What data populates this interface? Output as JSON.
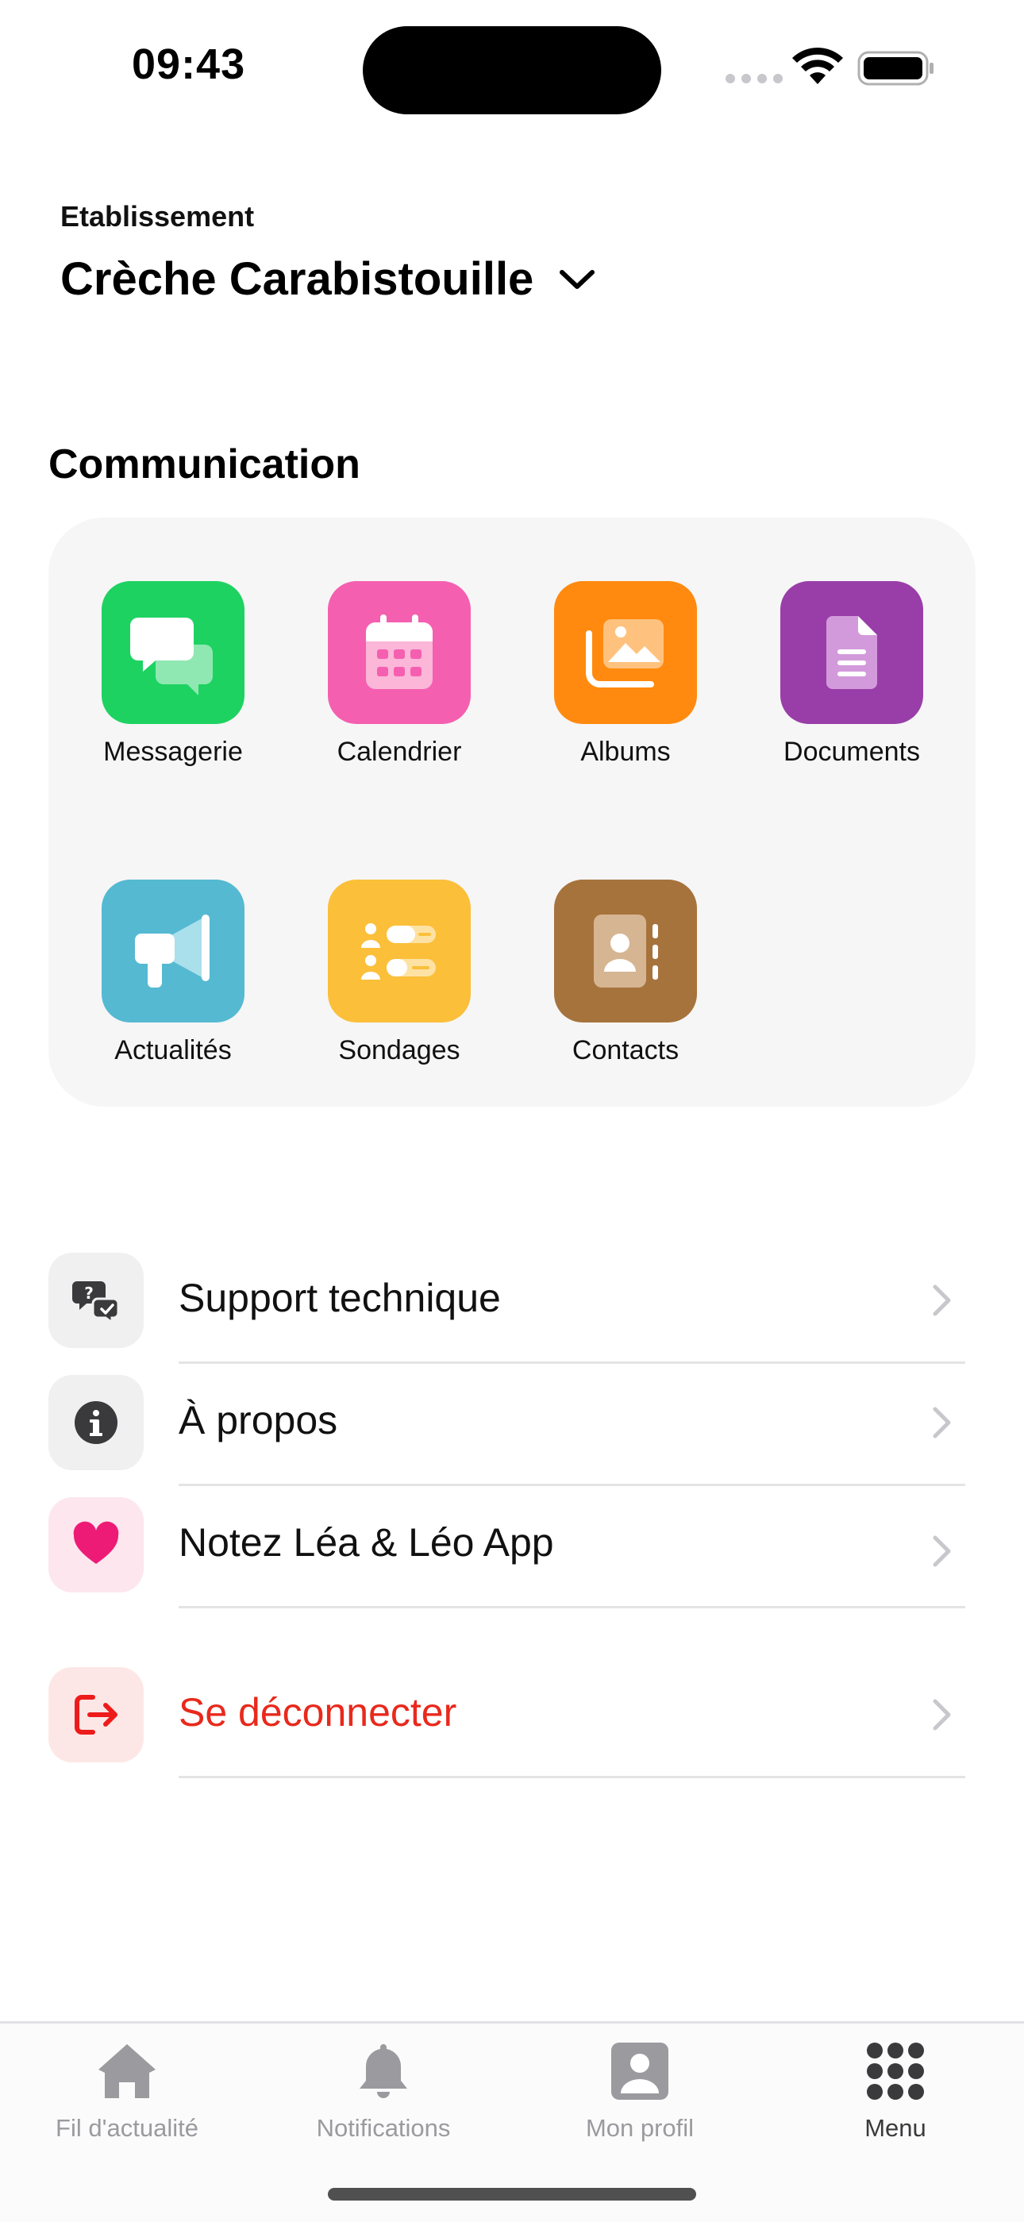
{
  "status_bar": {
    "time": "09:43"
  },
  "header": {
    "label": "Etablissement",
    "establishment_name": "Crèche Carabistouille"
  },
  "communication": {
    "title": "Communication",
    "items": [
      {
        "label": "Messagerie",
        "icon": "chat-bubbles-icon",
        "color": "#1ed262"
      },
      {
        "label": "Calendrier",
        "icon": "calendar-icon",
        "color": "#f55fb0"
      },
      {
        "label": "Albums",
        "icon": "photo-album-icon",
        "color": "#ff8a0f"
      },
      {
        "label": "Documents",
        "icon": "document-icon",
        "color": "#993ea8"
      },
      {
        "label": "Actualités",
        "icon": "megaphone-icon",
        "color": "#55b9d2"
      },
      {
        "label": "Sondages",
        "icon": "poll-icon",
        "color": "#fbbf3a"
      },
      {
        "label": "Contacts",
        "icon": "contact-book-icon",
        "color": "#a6733c"
      }
    ]
  },
  "menu": {
    "items": [
      {
        "label": "Support technique",
        "icon": "support-chat-icon",
        "icon_bg": "#f0f0f0"
      },
      {
        "label": "À propos",
        "icon": "info-icon",
        "icon_bg": "#f0f0f0"
      },
      {
        "label": "Notez Léa & Léo App",
        "icon": "heart-icon",
        "icon_bg": "#fde6ee",
        "icon_color": "#ee1b76"
      },
      {
        "label": "Se déconnecter",
        "icon": "logout-icon",
        "icon_bg": "#fde7e6",
        "icon_color": "#ee1b1b",
        "label_color": "#e8291c"
      }
    ]
  },
  "tab_bar": {
    "tabs": [
      {
        "label": "Fil d'actualité",
        "icon": "home-icon"
      },
      {
        "label": "Notifications",
        "icon": "bell-icon"
      },
      {
        "label": "Mon profil",
        "icon": "profile-icon"
      },
      {
        "label": "Menu",
        "icon": "grid-menu-icon",
        "active": true
      }
    ]
  }
}
